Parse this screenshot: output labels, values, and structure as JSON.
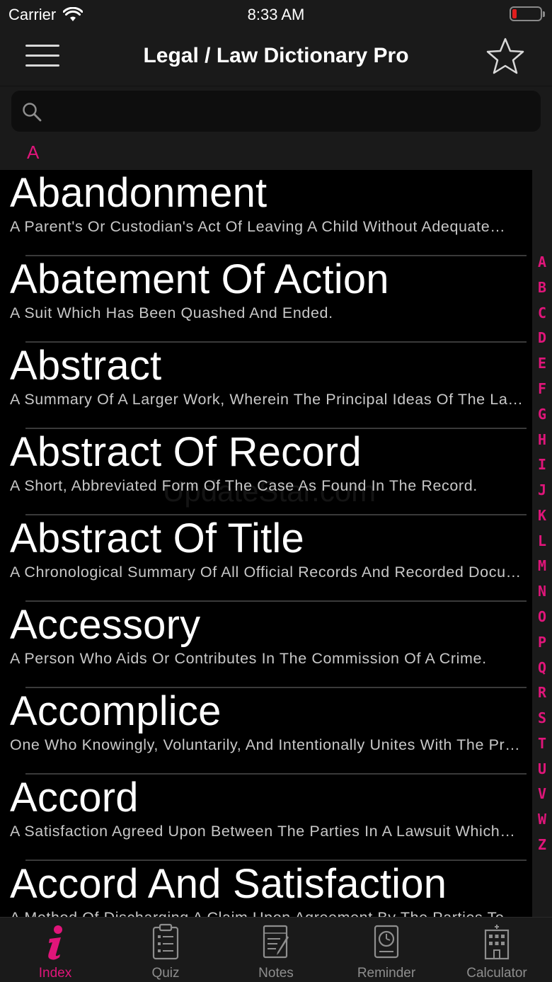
{
  "status": {
    "carrier": "Carrier",
    "time": "8:33 AM"
  },
  "nav": {
    "title": "Legal / Law Dictionary Pro"
  },
  "search": {
    "placeholder": ""
  },
  "section_header": "A",
  "entries": [
    {
      "term": "Abandonment",
      "definition": "A Parent's Or Custodian's Act Of Leaving A Child Without Adequate…"
    },
    {
      "term": "Abatement Of Action",
      "definition": "A Suit Which Has Been Quashed And Ended."
    },
    {
      "term": "Abstract",
      "definition": "A Summary Of A Larger Work, Wherein The Principal Ideas Of The La…"
    },
    {
      "term": "Abstract Of Record",
      "definition": "A Short, Abbreviated Form Of The Case As Found In The Record."
    },
    {
      "term": "Abstract Of Title",
      "definition": "A Chronological Summary Of All Official Records And Recorded Docu…"
    },
    {
      "term": "Accessory",
      "definition": "A Person Who Aids Or Contributes In The Commission Of A Crime."
    },
    {
      "term": "Accomplice",
      "definition": "One Who Knowingly, Voluntarily, And Intentionally Unites With The Pr…"
    },
    {
      "term": "Accord",
      "definition": "A Satisfaction Agreed Upon Between The Parties In A Lawsuit Which…"
    },
    {
      "term": "Accord And Satisfaction",
      "definition": "A Method Of Discharging A Claim Upon Agreement By The Parties To…"
    }
  ],
  "index_letters": [
    "A",
    "B",
    "C",
    "D",
    "E",
    "F",
    "G",
    "H",
    "I",
    "J",
    "K",
    "L",
    "M",
    "N",
    "O",
    "P",
    "Q",
    "R",
    "S",
    "T",
    "U",
    "V",
    "W",
    "Z"
  ],
  "watermark": "UpdateStar.com",
  "tabs": [
    {
      "label": "Index",
      "icon": "info-icon",
      "active": true
    },
    {
      "label": "Quiz",
      "icon": "clipboard-icon",
      "active": false
    },
    {
      "label": "Notes",
      "icon": "notes-icon",
      "active": false
    },
    {
      "label": "Reminder",
      "icon": "clock-icon",
      "active": false
    },
    {
      "label": "Calculator",
      "icon": "building-icon",
      "active": false
    }
  ],
  "colors": {
    "accent": "#e0157a",
    "background": "#000000",
    "bar": "#1a1a1a",
    "battery_low": "#e01e1e"
  }
}
